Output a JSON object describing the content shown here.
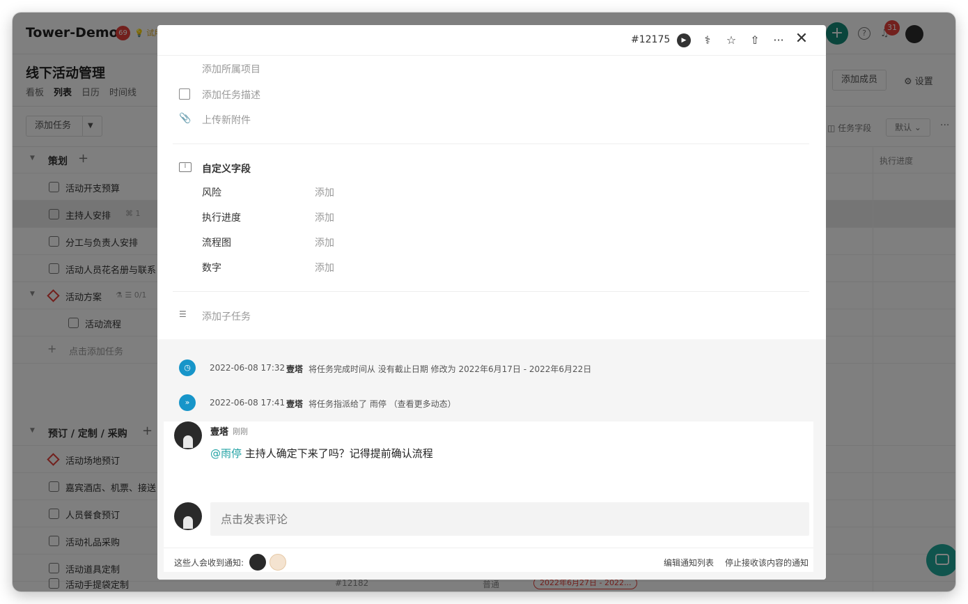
{
  "app": {
    "brand": "Tower-Demo",
    "brand_badge": "69",
    "trial_tag": "💡 试用",
    "notifications_badge": "31",
    "help_glyph": "?",
    "plus_glyph": "+"
  },
  "project": {
    "title": "线下活动管理",
    "views": [
      "看板",
      "列表",
      "日历",
      "时间线"
    ],
    "active_view": "列表",
    "add_member": "添加成员",
    "settings": "设置"
  },
  "toolbar": {
    "add_task": "添加任务",
    "task_fields": "任务字段",
    "default_view": "默认 ⌄",
    "more": "···"
  },
  "list": {
    "group1": "策划",
    "group1_add": "+",
    "items1": [
      {
        "text": "活动开支预算"
      },
      {
        "text": "主持人安排",
        "meta": "⌘ 1"
      },
      {
        "text": "分工与负责人安排"
      },
      {
        "text": "活动人员花名册与联系"
      }
    ],
    "milestone1": "活动方案",
    "milestone1_meta": "⚗ ☰ 0/1",
    "sub1": "活动流程",
    "add_hint": "点击添加任务",
    "group2": "预订 / 定制 / 采购",
    "group2_add": "+",
    "milestone2": "活动场地预订",
    "items2": [
      {
        "text": "嘉宾酒店、机票、接送"
      },
      {
        "text": "人员餐食预订"
      },
      {
        "text": "活动礼品采购"
      },
      {
        "text": "活动道具定制"
      },
      {
        "text": "活动手提袋定制"
      }
    ],
    "right_col_header": "执行进度",
    "last_code": "#12182",
    "last_prio": "普通",
    "last_range": "2022年6月27日 - 2022..."
  },
  "modal": {
    "task_no": "#12175",
    "add_project": "添加所属项目",
    "add_desc": "添加任务描述",
    "upload": "上传新附件",
    "custom_fields_title": "自定义字段",
    "custom_fields": [
      {
        "key": "风险",
        "value": "添加"
      },
      {
        "key": "执行进度",
        "value": "添加"
      },
      {
        "key": "流程图",
        "value": "添加"
      },
      {
        "key": "数字",
        "value": "添加"
      }
    ],
    "add_subtask": "添加子任务",
    "activities": [
      {
        "time": "2022-06-08 17:32",
        "who": "壹塔",
        "what": "将任务完成时间从 没有截止日期 修改为 2022年6月17日 - 2022年6月22日"
      },
      {
        "time": "2022-06-08 17:41",
        "who": "壹塔",
        "what": "将任务指派给了 雨停 （查看更多动态）"
      }
    ]
  },
  "comment": {
    "author": "壹塔",
    "time": "刚刚",
    "mention": "@雨停",
    "text": " 主持人确定下来了吗？记得提前确认流程",
    "input_placeholder": "点击发表评论",
    "notify_label": "这些人会收到通知:",
    "edit_notify": "编辑通知列表",
    "stop_notify": "停止接收该内容的通知"
  },
  "colors": {
    "accent_teal": "#148a78",
    "badge_red": "#e4413a",
    "mention": "#1fa1a3",
    "activity_blue": "#1795c9"
  }
}
